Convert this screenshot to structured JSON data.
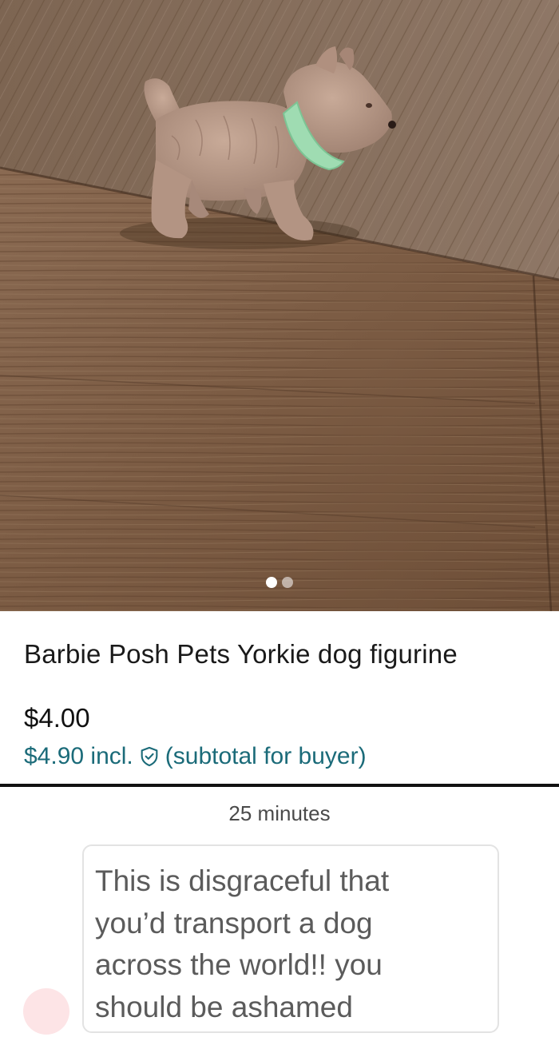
{
  "carousel": {
    "image_alt": "Barbie Posh Pets Yorkie dog figurine on a wooden floor",
    "dots": [
      {
        "active": true
      },
      {
        "active": false
      }
    ]
  },
  "listing": {
    "title": "Barbie Posh Pets Yorkie dog figurine",
    "price": "$4.00",
    "price_incl_amount": "$4.90",
    "price_incl_word": "incl.",
    "price_incl_note": "(subtotal for buyer)",
    "protection_icon": "shield-check-icon"
  },
  "chat": {
    "timestamp": "25 minutes",
    "message_lines": [
      "This is disgraceful that",
      "you’d transport a dog",
      "across the world!! you",
      "should be ashamed"
    ]
  },
  "colors": {
    "incl_price": "#1b6b79",
    "avatar": "#fde4e6",
    "divider": "#111111"
  }
}
